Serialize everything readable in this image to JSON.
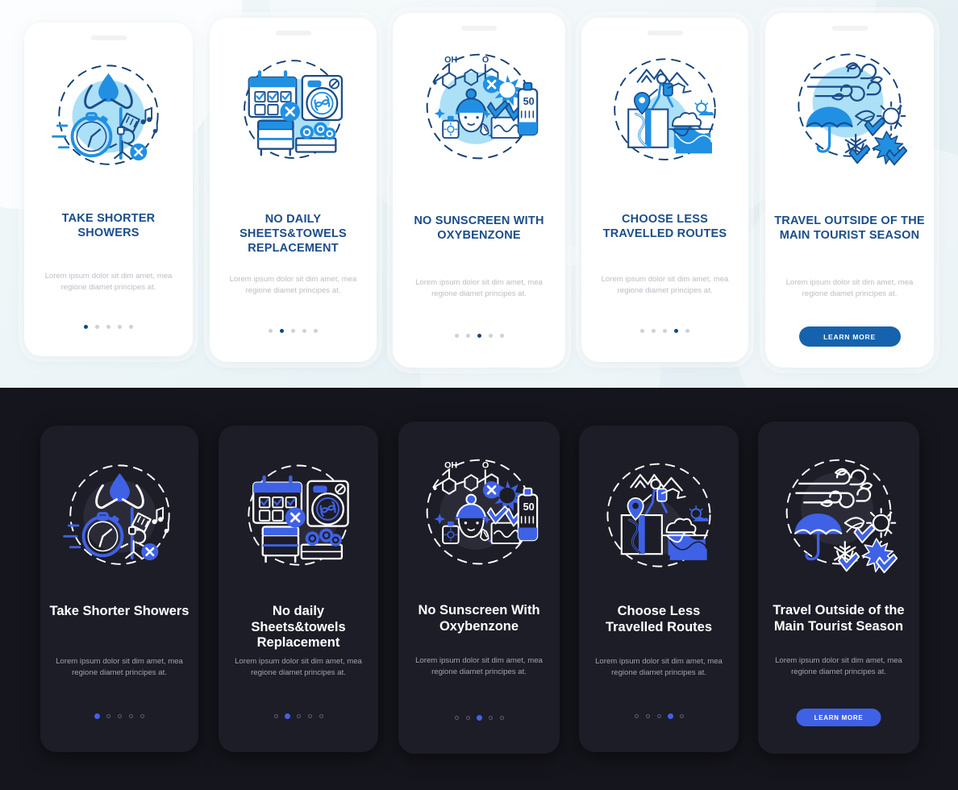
{
  "theme_colors": {
    "light_bg_start": "#f2f8fa",
    "light_bg_end": "#e3eef2",
    "light_card_bg": "#ffffff",
    "light_title": "#1b4d8a",
    "light_body_text": "#b9bec4",
    "light_accent": "#1e8fe0",
    "light_accent_pale": "#ace0f7",
    "light_accent_dark": "#14477f",
    "light_dot_inactive": "#ccd2d8",
    "light_cta_bg": "#1563ae",
    "dark_bg": "#15151d",
    "dark_card_bg": "#1d1d27",
    "dark_title": "#ffffff",
    "dark_body_text": "#9ea3ad",
    "dark_accent": "#3f61e6",
    "dark_line": "#ffffff",
    "dark_dot_inactive": "#5a5f72",
    "dark_cta_bg": "#3f61e6"
  },
  "shared": {
    "body_text": "Lorem ipsum dolor sit dim amet, mea regione diamet principes at.",
    "cta_label": "LEARN MORE",
    "dot_count": 5
  },
  "light_section": {
    "cards": [
      {
        "title": "TAKE SHORTER SHOWERS",
        "body": "Lorem ipsum dolor sit dim amet, mea regione diamet principes at.",
        "active_dot": 0,
        "has_cta": false,
        "illustration": "shower-timer-icon"
      },
      {
        "title": "NO DAILY SHEETS&TOWELS REPLACEMENT",
        "body": "Lorem ipsum dolor sit dim amet, mea regione diamet principes at.",
        "active_dot": 1,
        "has_cta": false,
        "illustration": "laundry-calendar-icon"
      },
      {
        "title": "NO SUNSCREEN WITH OXYBENZONE",
        "body": "Lorem ipsum dolor sit dim amet, mea regione diamet principes at.",
        "active_dot": 2,
        "has_cta": false,
        "illustration": "sunscreen-oxybenzone-icon",
        "spf_label": "50",
        "molecule_labels": [
          "OH",
          "O"
        ]
      },
      {
        "title": "CHOOSE LESS TRAVELLED ROUTES",
        "body": "Lorem ipsum dolor sit dim amet, mea regione diamet principes at.",
        "active_dot": 3,
        "has_cta": false,
        "illustration": "hiking-map-route-icon"
      },
      {
        "title": "TRAVEL OUTSIDE OF THE MAIN TOURIST SEASON",
        "body": "Lorem ipsum dolor sit dim amet, mea regione diamet principes at.",
        "active_dot": 4,
        "has_cta": true,
        "cta_label": "LEARN MORE",
        "illustration": "four-seasons-umbrella-icon"
      }
    ]
  },
  "dark_section": {
    "cards": [
      {
        "title": "Take Shorter Showers",
        "body": "Lorem ipsum dolor sit dim amet, mea regione diamet principes at.",
        "active_dot": 0,
        "has_cta": false,
        "illustration": "shower-timer-icon"
      },
      {
        "title": "No daily Sheets&towels Replacement",
        "body": "Lorem ipsum dolor sit dim amet, mea regione diamet principes at.",
        "active_dot": 1,
        "has_cta": false,
        "illustration": "laundry-calendar-icon"
      },
      {
        "title": "No Sunscreen With Oxybenzone",
        "body": "Lorem ipsum dolor sit dim amet, mea regione diamet principes at.",
        "active_dot": 2,
        "has_cta": false,
        "illustration": "sunscreen-oxybenzone-icon",
        "spf_label": "50",
        "molecule_labels": [
          "OH",
          "O"
        ]
      },
      {
        "title": "Choose Less Travelled Routes",
        "body": "Lorem ipsum dolor sit dim amet, mea regione diamet principes at.",
        "active_dot": 3,
        "has_cta": false,
        "illustration": "hiking-map-route-icon"
      },
      {
        "title": "Travel Outside of the Main Tourist Season",
        "body": "Lorem ipsum dolor sit dim amet, mea regione diamet principes at.",
        "active_dot": 4,
        "has_cta": true,
        "cta_label": "LEARN MORE",
        "illustration": "four-seasons-umbrella-icon"
      }
    ]
  }
}
